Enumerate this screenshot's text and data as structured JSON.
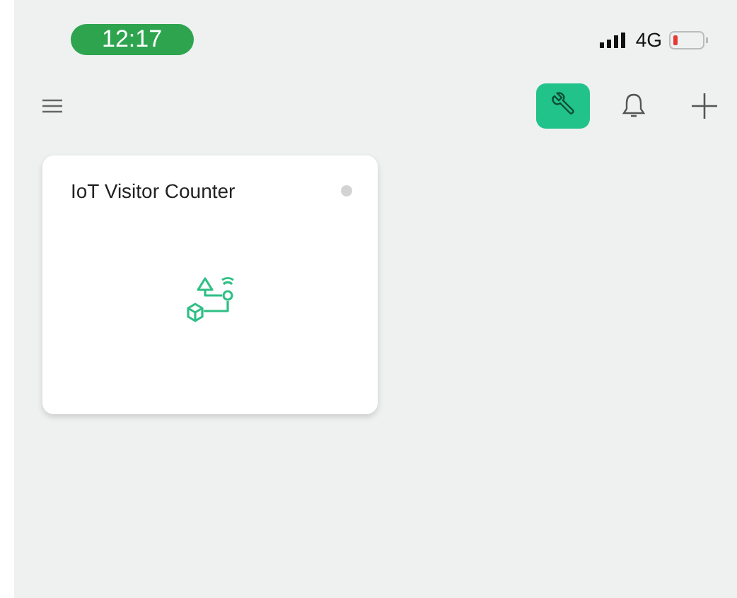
{
  "status_bar": {
    "time": "12:17",
    "network": "4G"
  },
  "toolbar": [
    {
      "kind": "wrench",
      "selected": true
    },
    {
      "kind": "bell",
      "selected": false
    },
    {
      "kind": "plus",
      "selected": false
    }
  ],
  "devices": [
    {
      "name": "IoT Visitor Counter",
      "online": false
    }
  ]
}
